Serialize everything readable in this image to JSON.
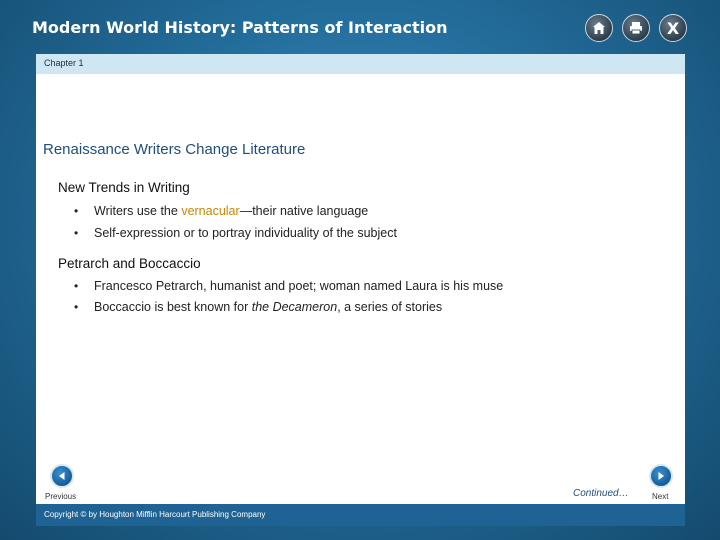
{
  "app": {
    "title": "Modern World History: Patterns of Interaction",
    "home_icon": "home-icon",
    "print_icon": "print-icon",
    "close_label": "X"
  },
  "chapter": {
    "label": "Chapter 1"
  },
  "slide": {
    "title": "Renaissance Writers Change Literature",
    "sections": [
      {
        "heading": "New Trends in Writing",
        "bullets": [
          {
            "pre": "Writers use the ",
            "highlight": "vernacular",
            "post": "—their native language"
          },
          {
            "text": "Self-expression or to portray individuality of the subject"
          }
        ]
      },
      {
        "heading": "Petrarch and Boccaccio",
        "bullets": [
          {
            "text": "Francesco Petrarch, humanist and poet; woman named Laura is his muse"
          },
          {
            "pre": "Boccaccio is best known for ",
            "emphasis": "the Decameron",
            "post": ", a series of stories"
          }
        ]
      }
    ]
  },
  "nav": {
    "previous_label": "Previous",
    "next_label": "Next",
    "continued_label": "Continued…"
  },
  "footer": {
    "copyright": "Copyright © by Houghton Mifflin Harcourt Publishing Company"
  },
  "colors": {
    "frame": "#236d9b",
    "chapter_bar": "#cfe6f3",
    "title": "#1f4e7a",
    "highlight": "#c8860a",
    "footer": "#1f6394"
  }
}
